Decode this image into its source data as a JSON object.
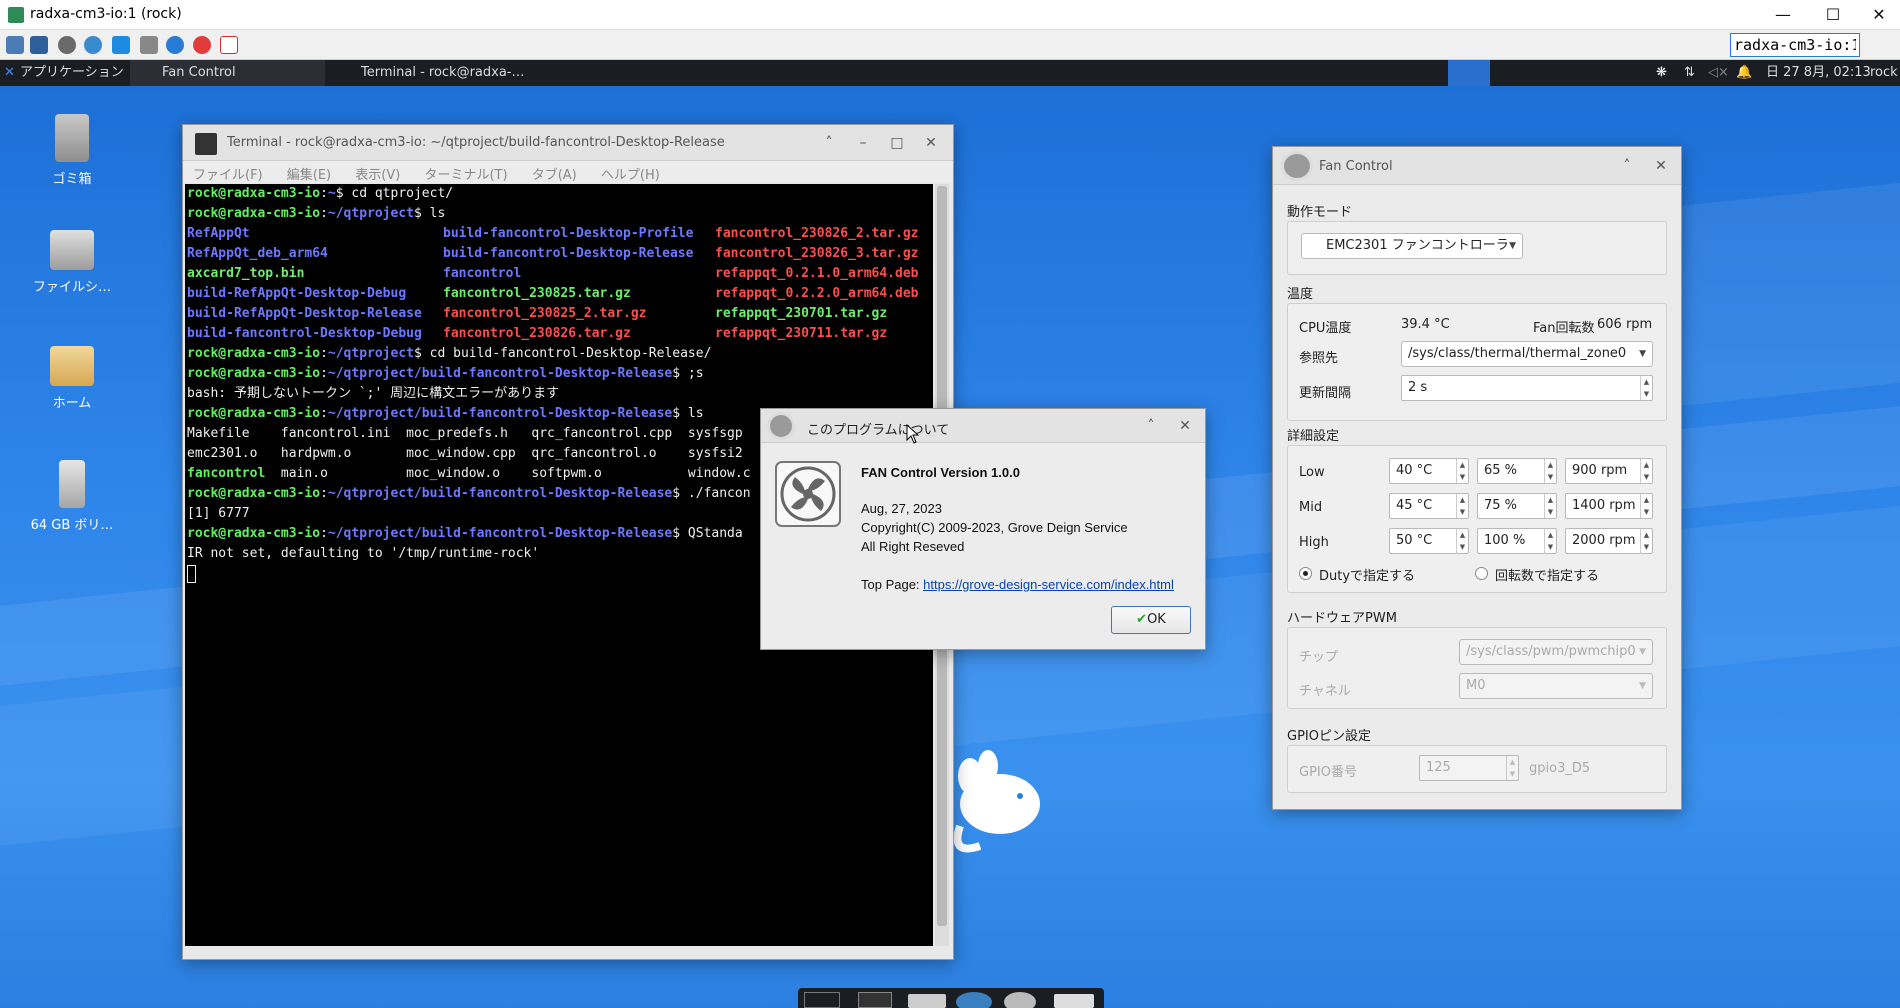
{
  "vnc": {
    "title": "radxa-cm3-io:1 (rock)",
    "host_value": "radxa-cm3-io:1",
    "minimize": "—",
    "maximize": "☐",
    "close": "✕"
  },
  "panel": {
    "applications": "アプリケーション",
    "tasks": [
      "Fan Control",
      "Terminal - rock@radxa-…"
    ],
    "clock": "日 27 8月, 02:13",
    "user": "rock"
  },
  "desktop_icons": [
    {
      "label": "ゴミ箱",
      "icon": "trash-icon"
    },
    {
      "label": "ファイルシ…",
      "icon": "drive-icon"
    },
    {
      "label": "ホーム",
      "icon": "home-folder-icon"
    },
    {
      "label": "64 GB ボリ…",
      "icon": "usb-drive-icon"
    }
  ],
  "terminal": {
    "title": "Terminal - rock@radxa-cm3-io: ~/qtproject/build-fancontrol-Desktop-Release",
    "menu": [
      "ファイル(F)",
      "編集(E)",
      "表示(V)",
      "ターミナル(T)",
      "タブ(A)",
      "ヘルプ(H)"
    ],
    "prompt_host": "rock@radxa-cm3-io",
    "lines": {
      "l1_path": "~",
      "l1_cmd": "$ cd qtproject/",
      "l2_path": "~/qtproject",
      "l2_cmd": "$ ls",
      "ls1": [
        [
          "RefAppQt",
          "build-fancontrol-Desktop-Profile",
          "fancontrol_230826_2.tar.gz"
        ],
        [
          "RefAppQt_deb_arm64",
          "build-fancontrol-Desktop-Release",
          "fancontrol_230826_3.tar.gz"
        ],
        [
          "axcard7_top.bin",
          "fancontrol",
          "refappqt_0.2.1.0_arm64.deb"
        ],
        [
          "build-RefAppQt-Desktop-Debug",
          "fancontrol_230825.tar.gz",
          "refappqt_0.2.2.0_arm64.deb"
        ],
        [
          "build-RefAppQt-Desktop-Release",
          "fancontrol_230825_2.tar.gz",
          "refappqt_230701.tar.gz"
        ],
        [
          "build-fancontrol-Desktop-Debug",
          "fancontrol_230826.tar.gz",
          "refappqt_230711.tar.gz"
        ]
      ],
      "l9_cmd": "$ cd build-fancontrol-Desktop-Release/",
      "rel_path": "~/qtproject/build-fancontrol-Desktop-Release",
      "l10_cmd": "$ ;s",
      "l11": "bash: 予期しないトークン `;' 周辺に構文エラーがあります",
      "l12_cmd": "$ ls",
      "ls2_row1": "Makefile    fancontrol.ini  moc_predefs.h   qrc_fancontrol.cpp  sysfsgp",
      "ls2_row2": "emc2301.o   hardpwm.o       moc_window.cpp  qrc_fancontrol.o    sysfsi2",
      "ls2_row3_a": "fancontrol",
      "ls2_row3_b": "  main.o          moc_window.o    softpwm.o           window.c",
      "l16_cmd": "$ ./fancon",
      "l17": "[1] 6777",
      "l18_cmd": "$ QStanda",
      "l19": "IR not set, defaulting to '/tmp/runtime-rock'"
    }
  },
  "fan": {
    "title": "Fan Control",
    "mode_label": "動作モード",
    "mode_value": "EMC2301 ファンコントローラ",
    "temp_label": "温度",
    "cpu_temp_label": "CPU温度",
    "cpu_temp_value": "39.4  °C",
    "fan_rpm_label": "Fan回転数",
    "fan_rpm_value": "606  rpm",
    "ref_label": "参照先",
    "ref_value": "/sys/class/thermal/thermal_zone0",
    "interval_label": "更新間隔",
    "interval_value": "2 s",
    "detail_label": "詳細設定",
    "rows": [
      {
        "name": "Low",
        "temp": "40 °C",
        "duty": "65 %",
        "rpm": "900 rpm"
      },
      {
        "name": "Mid",
        "temp": "45 °C",
        "duty": "75 %",
        "rpm": "1400 rpm"
      },
      {
        "name": "High",
        "temp": "50 °C",
        "duty": "100 %",
        "rpm": "2000 rpm"
      }
    ],
    "radio_duty": "Dutyで指定する",
    "radio_rpm": "回転数で指定する",
    "hwpwm_label": "ハードウェアPWM",
    "chip_label": "チップ",
    "chip_value": "/sys/class/pwm/pwmchip0",
    "channel_label": "チャネル",
    "channel_value": "M0",
    "gpio_label": "GPIOピン設定",
    "gpio_num_label": "GPIO番号",
    "gpio_num_value": "125",
    "gpio_name": "gpio3_D5"
  },
  "about": {
    "title": "このプログラムについて",
    "version": "FAN Control Version 1.0.0",
    "date": "Aug, 27, 2023",
    "copyright": "Copyright(C) 2009-2023, Grove Deign Service",
    "rights": "All Right Reseved",
    "top_page_label": "Top Page: ",
    "link": "https://grove-design-service.com/index.html",
    "ok": "OK"
  }
}
